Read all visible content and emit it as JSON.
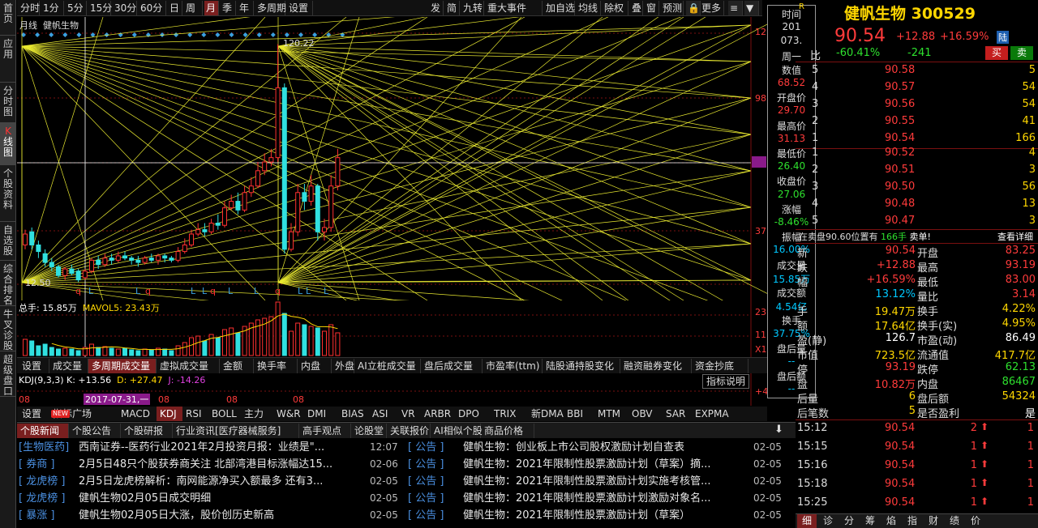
{
  "leftbar": [
    "首页",
    "应用",
    "分时图",
    "K线图",
    "个股资料",
    "自选股",
    "综合排名",
    "牛叉诊股",
    "超级盘口"
  ],
  "toolbar": [
    "分时",
    "1分",
    "5分",
    "15分",
    "30分",
    "60分",
    "日",
    "周",
    "月",
    "季",
    "年",
    "多周期",
    "设置"
  ],
  "toolbar_right": [
    "发",
    "简",
    "九转",
    "重大事件",
    "加自选",
    "均线",
    "除权",
    "叠",
    "窗",
    "预测",
    "更多"
  ],
  "chart_header": {
    "period": "月线",
    "name": "健帆生物"
  },
  "price_labels": {
    "p120": "120.22",
    "p12": "12.50",
    "axis_top": "12",
    "axis_98": "98",
    "axis_68": "68",
    "axis_37": "37"
  },
  "kline_markers": [
    "q",
    "L",
    "L",
    "q",
    "L",
    "L",
    "q",
    "L",
    "L",
    "q",
    "L",
    "L",
    "L"
  ],
  "vol": {
    "label": "总手: 15.85万",
    "ma5": "MAVOL5: 23.43万",
    "ax23": "23",
    "ax11": "11",
    "axx1": "X1"
  },
  "ind_tabs": [
    "设置",
    "成交量",
    "多周期成交量",
    "虚拟成交量",
    "金额",
    "换手率",
    "内盘",
    "外盘",
    "AI立桩成交量",
    "盘后成交量",
    "市盈率(ttm)",
    "陆股通持股变化",
    "融资融券变化",
    "资金抄底",
    "指标说明"
  ],
  "kdj": {
    "title": "KDJ(9,3,3)",
    "k": "K: +13.56",
    "d": "D: +27.47",
    "j": "J: -14.26",
    "x_labels": [
      "08",
      "2017-07-31,一",
      "08",
      "08",
      "08"
    ]
  },
  "ind_tabs2": [
    "设置",
    "指标广场",
    "MACD",
    "KDJ",
    "RSI",
    "BOLL",
    "主力",
    "W&R",
    "DMI",
    "BIAS",
    "ASI",
    "VR",
    "ARBR",
    "DPO",
    "TRIX",
    "新DMA",
    "BBI",
    "MTM",
    "OBV",
    "SAR",
    "EXPMA"
  ],
  "news_tabs": [
    "个股新闻",
    "个股公告",
    "个股研报",
    "行业资讯[医疗器械服务]",
    "高手观点",
    "论股堂",
    "关联报价",
    "AI相似个股",
    "商品价格"
  ],
  "news_left": [
    {
      "tag": "[生物医药]",
      "text": "西南证券--医药行业2021年2月投资月报：业绩是\"...",
      "date": "12:07"
    },
    {
      "tag": "[ 券商 ]",
      "text": "2月5日48只个股获券商关注 北部湾港目标涨幅达15...",
      "date": "02-06"
    },
    {
      "tag": "[ 龙虎榜 ]",
      "text": "2月5日龙虎榜解析：南网能源净买入额最多 还有3...",
      "date": "02-05"
    },
    {
      "tag": "[ 龙虎榜 ]",
      "text": "健帆生物02月05日成交明细",
      "date": "02-05"
    },
    {
      "tag": "[ 暴涨 ]",
      "text": "健帆生物02月05日大涨，股价创历史新高",
      "date": "02-05"
    }
  ],
  "news_right": [
    {
      "tag": "[ 公告 ]",
      "text": "健帆生物：创业板上市公司股权激励计划自查表",
      "date": "02-05"
    },
    {
      "tag": "[ 公告 ]",
      "text": "健帆生物：2021年限制性股票激励计划（草案）摘...",
      "date": "02-05"
    },
    {
      "tag": "[ 公告 ]",
      "text": "健帆生物：2021年限制性股票激励计划实施考核管...",
      "date": "02-05"
    },
    {
      "tag": "[ 公告 ]",
      "text": "健帆生物：2021年限制性股票激励计划激励对象名...",
      "date": "02-05"
    },
    {
      "tag": "[ 公告 ]",
      "text": "健帆生物：2021年限制性股票激励计划（草案）",
      "date": "02-05"
    }
  ],
  "popup": [
    "时间",
    "201",
    "073.",
    "周一",
    "数值",
    "68.52",
    "开盘价",
    "29.70",
    "最高价",
    "31.13",
    "最低价",
    "26.40",
    "收盘价",
    "27.06",
    "涨幅",
    "-8.46%",
    "振幅",
    "16.00%",
    "成交量",
    "15.85万",
    "成交额",
    "4.54亿",
    "换手",
    "37.75%",
    "盘后量",
    "--",
    "盘后额",
    "--"
  ],
  "stock": {
    "name": "健帆生物",
    "code": "300529",
    "price": "90.54",
    "chg": "+12.88",
    "pct": "+16.59%",
    "tag": "陆",
    "r": "R",
    "wb": "-60.41%",
    "wc": "-241",
    "buy": "买",
    "sell": "卖"
  },
  "sell_book": [
    {
      "p": "90.58",
      "v": "5"
    },
    {
      "p": "90.57",
      "v": "54"
    },
    {
      "p": "90.56",
      "v": "54"
    },
    {
      "p": "90.55",
      "v": "41"
    },
    {
      "p": "90.54",
      "v": "166"
    }
  ],
  "buy_book": [
    {
      "p": "90.52",
      "v": "4"
    },
    {
      "p": "90.51",
      "v": "3"
    },
    {
      "p": "90.50",
      "v": "56"
    },
    {
      "p": "90.48",
      "v": "13"
    },
    {
      "p": "90.47",
      "v": "3"
    }
  ],
  "book_idx": [
    "5",
    "4",
    "3",
    "2",
    "1",
    "1",
    "2",
    "3",
    "4",
    "5"
  ],
  "notice": {
    "pre": "在卖盘90.60位置有",
    "vol": "166手",
    "post": "卖单!",
    "link": "查看详细"
  },
  "quote": [
    {
      "l": "新",
      "v": "90.54",
      "l2": "开盘",
      "v2": "83.25"
    },
    {
      "l": "跌",
      "v": "+12.88",
      "l2": "最高",
      "v2": "93.19"
    },
    {
      "l": "幅",
      "v": "+16.59%",
      "l2": "最低",
      "v2": "83.00"
    },
    {
      "l": "",
      "v": "13.12%",
      "l2": "量比",
      "v2": "3.14"
    },
    {
      "l": "手",
      "v": "19.47万",
      "l2": "换手",
      "v2": "4.22%"
    },
    {
      "l": "额",
      "v": "17.64亿",
      "l2": "换手(实)",
      "v2": "4.95%"
    },
    {
      "l": "盈(静)",
      "v": "126.7",
      "l2": "市盈(动)",
      "v2": "86.49"
    },
    {
      "l": "市值",
      "v": "723.5亿",
      "l2": "流通值",
      "v2": "417.7亿"
    },
    {
      "l": "停",
      "v": "93.19",
      "l2": "跌停",
      "v2": "62.13"
    },
    {
      "l": "盘",
      "v": "10.82万",
      "l2": "内盘",
      "v2": "86467"
    },
    {
      "l": "后量",
      "v": "6",
      "l2": "盘后额",
      "v2": "54324"
    },
    {
      "l": "后笔数",
      "v": "5",
      "l2": "是否盈利",
      "v2": "是"
    }
  ],
  "ticks": [
    {
      "t": "15:12",
      "p": "90.54",
      "v": "2",
      "n": "1"
    },
    {
      "t": "15:15",
      "p": "90.54",
      "v": "1",
      "n": "1"
    },
    {
      "t": "15:16",
      "p": "90.54",
      "v": "1",
      "n": "1"
    },
    {
      "t": "15:18",
      "p": "90.54",
      "v": "1",
      "n": "1"
    },
    {
      "t": "15:25",
      "p": "90.54",
      "v": "1",
      "n": "1"
    }
  ],
  "bottom_tabs": [
    "细",
    "诊",
    "分",
    "筹",
    "焰",
    "指",
    "财",
    "绩",
    "价"
  ],
  "candles": [
    {
      "o": 28,
      "c": 33,
      "h": 35,
      "l": 26
    },
    {
      "o": 34,
      "c": 28,
      "h": 36,
      "l": 26
    },
    {
      "o": 28,
      "c": 25,
      "h": 30,
      "l": 22
    },
    {
      "o": 24,
      "c": 20,
      "h": 26,
      "l": 18
    },
    {
      "o": 20,
      "c": 18,
      "h": 22,
      "l": 16
    },
    {
      "o": 18,
      "c": 14,
      "h": 19,
      "l": 13
    },
    {
      "o": 14,
      "c": 17,
      "h": 18,
      "l": 12
    },
    {
      "o": 17,
      "c": 15,
      "h": 19,
      "l": 14
    },
    {
      "o": 16,
      "c": 12,
      "h": 17,
      "l": 11
    },
    {
      "o": 13,
      "c": 16,
      "h": 17,
      "l": 12
    },
    {
      "o": 16,
      "c": 21,
      "h": 22,
      "l": 15
    },
    {
      "o": 21,
      "c": 19,
      "h": 23,
      "l": 17
    },
    {
      "o": 19,
      "c": 22,
      "h": 24,
      "l": 18
    },
    {
      "o": 22,
      "c": 21,
      "h": 24,
      "l": 19
    },
    {
      "o": 21,
      "c": 23,
      "h": 25,
      "l": 20
    },
    {
      "o": 23,
      "c": 22,
      "h": 25,
      "l": 21
    },
    {
      "o": 22,
      "c": 21,
      "h": 23,
      "l": 19
    },
    {
      "o": 21,
      "c": 20,
      "h": 23,
      "l": 18
    },
    {
      "o": 20,
      "c": 22,
      "h": 23,
      "l": 19
    },
    {
      "o": 22,
      "c": 21,
      "h": 24,
      "l": 20
    },
    {
      "o": 21,
      "c": 23,
      "h": 24,
      "l": 19
    },
    {
      "o": 23,
      "c": 22,
      "h": 24,
      "l": 20
    },
    {
      "o": 22,
      "c": 21,
      "h": 23,
      "l": 20
    },
    {
      "o": 21,
      "c": 25,
      "h": 27,
      "l": 20
    },
    {
      "o": 25,
      "c": 28,
      "h": 31,
      "l": 24
    },
    {
      "o": 28,
      "c": 33,
      "h": 35,
      "l": 27
    },
    {
      "o": 33,
      "c": 35,
      "h": 38,
      "l": 32
    },
    {
      "o": 35,
      "c": 34,
      "h": 38,
      "l": 32
    },
    {
      "o": 34,
      "c": 38,
      "h": 40,
      "l": 33
    },
    {
      "o": 38,
      "c": 37,
      "h": 42,
      "l": 35
    },
    {
      "o": 37,
      "c": 45,
      "h": 48,
      "l": 36
    },
    {
      "o": 45,
      "c": 48,
      "h": 51,
      "l": 44
    },
    {
      "o": 48,
      "c": 44,
      "h": 52,
      "l": 42
    },
    {
      "o": 44,
      "c": 52,
      "h": 55,
      "l": 43
    },
    {
      "o": 52,
      "c": 55,
      "h": 59,
      "l": 50
    },
    {
      "o": 55,
      "c": 62,
      "h": 66,
      "l": 54
    },
    {
      "o": 62,
      "c": 66,
      "h": 70,
      "l": 60
    },
    {
      "o": 66,
      "c": 68,
      "h": 72,
      "l": 64
    },
    {
      "o": 68,
      "c": 100,
      "h": 120,
      "l": 66
    },
    {
      "o": 100,
      "c": 26,
      "h": 102,
      "l": 24
    },
    {
      "o": 26,
      "c": 34,
      "h": 38,
      "l": 25
    },
    {
      "o": 34,
      "c": 52,
      "h": 56,
      "l": 32
    },
    {
      "o": 52,
      "c": 48,
      "h": 56,
      "l": 44
    },
    {
      "o": 48,
      "c": 55,
      "h": 60,
      "l": 46
    },
    {
      "o": 55,
      "c": 34,
      "h": 56,
      "l": 30
    },
    {
      "o": 34,
      "c": 36,
      "h": 40,
      "l": 30
    },
    {
      "o": 36,
      "c": 55,
      "h": 60,
      "l": 34
    },
    {
      "o": 55,
      "c": 68,
      "h": 72,
      "l": 53
    }
  ]
}
